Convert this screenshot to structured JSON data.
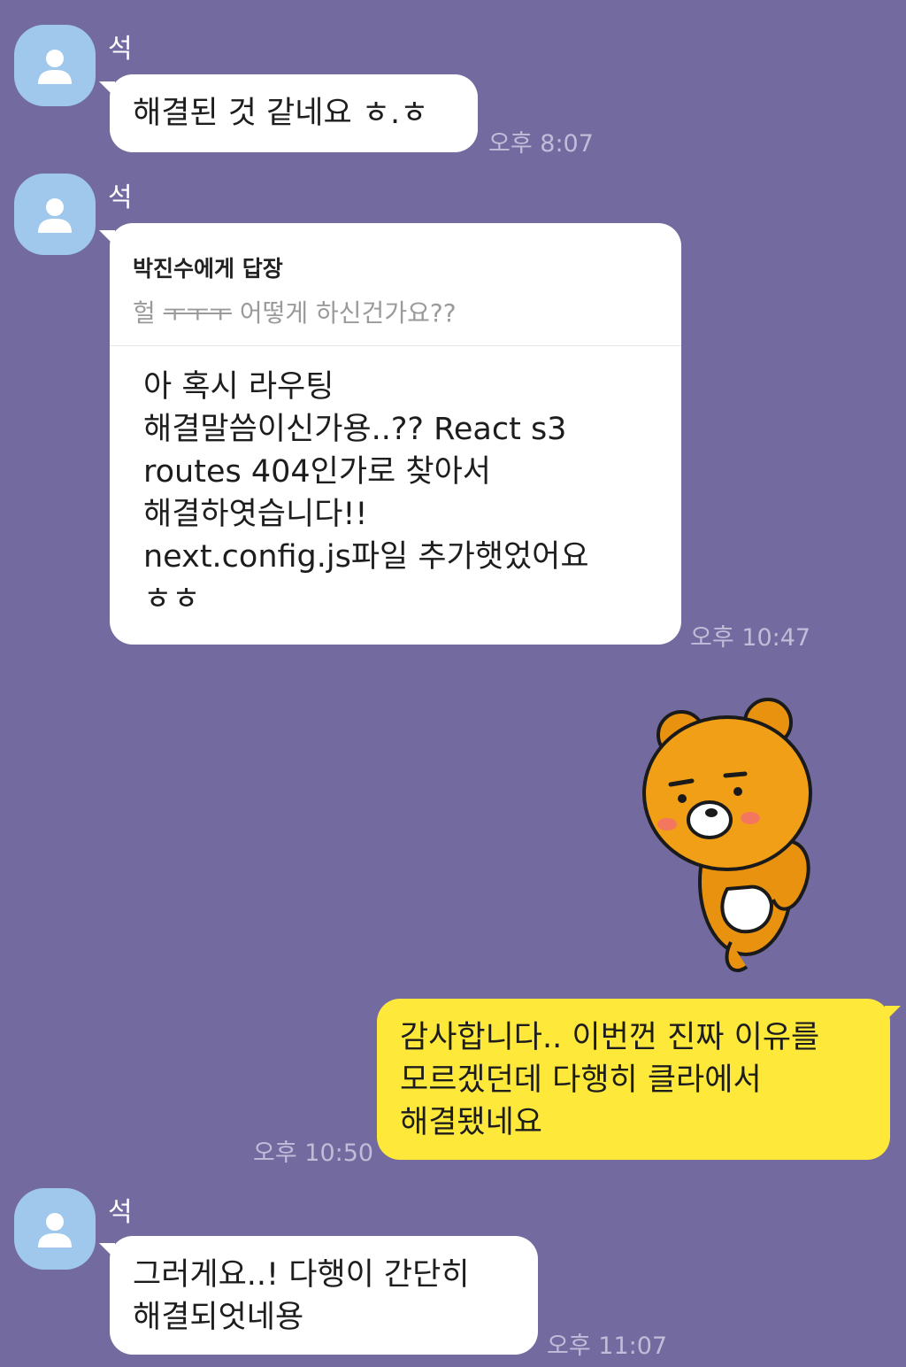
{
  "messages": [
    {
      "sender": "석",
      "text": "해결된 것 같네요 ㅎ.ㅎ",
      "time": "오후 8:07"
    },
    {
      "sender": "석",
      "reply": {
        "to": "박진수에게 답장",
        "quote_prefix": "헐 ",
        "quote_strike": "ㅜㅜㅜ",
        "quote_suffix": " 어떻게 하신건가요??"
      },
      "text": "아 혹시 라우팅\n해결말씀이신가용..?? React s3\nroutes 404인가로 찾아서\n해결하엿습니다!!\nnext.config.js파일 추가햇었어요\nㅎㅎ",
      "time": "오후 10:47"
    },
    {
      "sticker": "ryan-sticker"
    },
    {
      "mine": true,
      "text": "감사합니다.. 이번껀 진짜 이유를\n모르겠던데 다행히 클라에서\n해결됐네요",
      "time": "오후 10:50"
    },
    {
      "sender": "석",
      "text": "그러게요..! 다행이 간단히\n해결되엇네용",
      "time": "오후 11:07"
    }
  ],
  "colors": {
    "background": "#736a9f",
    "my_bubble": "#fee93b",
    "their_bubble": "#ffffff",
    "avatar": "#9fc8ec"
  }
}
